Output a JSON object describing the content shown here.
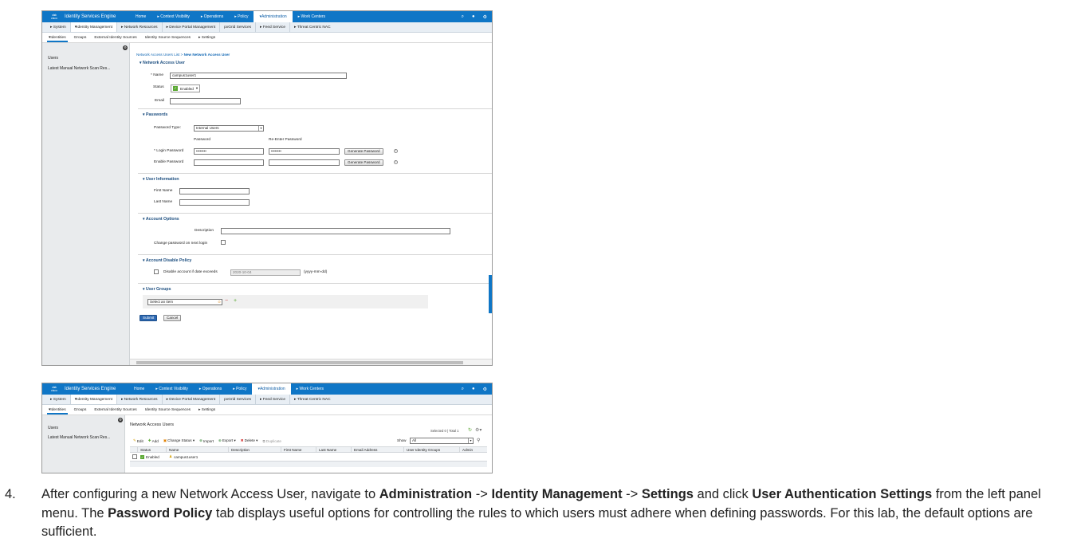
{
  "header": {
    "logo_text": "cisco",
    "product": "Identity Services Engine",
    "nav": [
      "Home",
      "▸ Context Visibility",
      "▸ Operations",
      "▸ Policy",
      "▾Administration",
      "▸ Work Centers"
    ],
    "nav_active_index": 4
  },
  "subnav": [
    "▸ System",
    "▾Identity Management",
    "▸ Network Resources",
    "▸ Device Portal Management",
    "pxGrid Services",
    "▸ Feed Service",
    "▸ Threat Centric NAC"
  ],
  "subnav_active_index": 1,
  "thirdnav": [
    "▾Identities",
    "Groups",
    "External Identity Sources",
    "Identity Source Sequences",
    "▸ Settings"
  ],
  "thirdnav_active_index": 0,
  "left_panel": {
    "items": [
      "Users",
      "Latest Manual Network Scan Res..."
    ]
  },
  "form": {
    "breadcrumb_link": "Network Access Users List >",
    "breadcrumb_current": "New Network Access User",
    "section_user": "Network Access User",
    "name_label": "* Name",
    "name_value": "campus1user1",
    "status_label": "Status",
    "status_value": "Enabled",
    "email_label": "Email",
    "email_value": "",
    "section_passwords": "Passwords",
    "password_type_label": "Password Type:",
    "password_type_value": "Internal Users",
    "col_password": "Password",
    "col_reenter": "Re-Enter Password",
    "login_password_label": "* Login Password",
    "login_password_value": "••••••••",
    "login_reenter_value": "••••••••",
    "enable_password_label": "Enable Password",
    "generate_label": "Generate Password",
    "section_user_info": "User Information",
    "first_name_label": "First Name",
    "last_name_label": "Last Name",
    "section_account_options": "Account Options",
    "description_label": "Description",
    "change_password_label": "Change password on next login",
    "section_disable_policy": "Account Disable Policy",
    "disable_label": "Disable account if date exceeds",
    "disable_date": "2020-10-04",
    "date_format": "(yyyy-mm-dd)",
    "section_user_groups": "User Groups",
    "select_item": "Select an item",
    "submit_label": "Submit",
    "cancel_label": "Cancel"
  },
  "list": {
    "title": "Network Access Users",
    "selected_info": "Selected 0 | Total 1",
    "toolbar": [
      "Edit",
      "Add",
      "Change Status ▾",
      "Import",
      "Export ▾",
      "Delete ▾",
      "Duplicate"
    ],
    "show_label": "Show",
    "show_value": "All",
    "columns": [
      "Status",
      "Name",
      "Description",
      "First Name",
      "Last Name",
      "Email Address",
      "User Identity Groups",
      "Admin"
    ],
    "rows": [
      {
        "status": "Enabled",
        "name": "campus1user1"
      }
    ]
  },
  "instruction": {
    "number": "4.",
    "t1": "After configuring a new Network Access User, navigate to ",
    "b1": "Administration",
    "t2": " -> ",
    "b2": "Identity Management",
    "t3": " -> ",
    "b3": "Settings",
    "t4": " and click ",
    "b4": "User Authentication Settings",
    "t5": " from the left panel menu. The ",
    "b5": "Password Policy",
    "t6": " tab displays useful options for controlling the rules to which users must adhere when defining passwords. For this lab, the default options are sufficient."
  },
  "colors": {
    "brand": "#0f76c6",
    "enabled": "#5aa832",
    "submit": "#2b67b1"
  }
}
